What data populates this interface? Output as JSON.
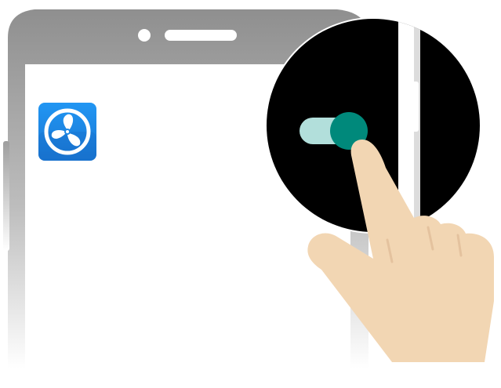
{
  "scene": {
    "description_hidden": "",
    "app": {
      "icon_name": "fan-icon",
      "accent": "#1e88e5"
    },
    "toggle": {
      "state": "on",
      "track_color": "#b2dfdb",
      "thumb_color": "#00897b"
    },
    "phone": {
      "frame_color": "#9e9e9e",
      "screen_color": "#ffffff",
      "zoom_background": "#000000"
    },
    "hand": {
      "skin_color": "#f2d6b3"
    }
  }
}
